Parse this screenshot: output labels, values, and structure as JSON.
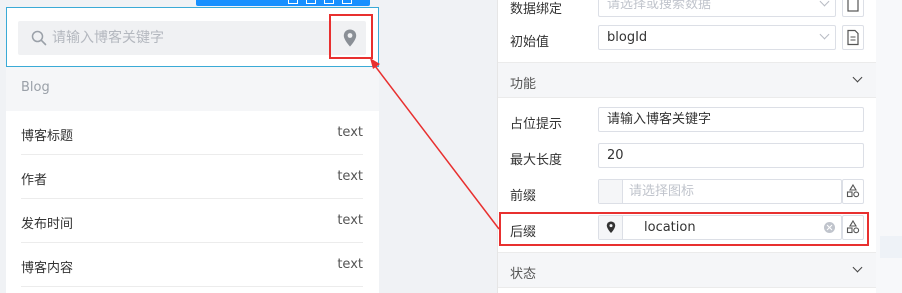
{
  "canvas": {
    "search": {
      "placeholder": "请输入博客关键字",
      "prefix_icon": "search-icon",
      "suffix_icon": "location-icon"
    },
    "list": {
      "header": "Blog",
      "rows": [
        {
          "name": "博客标题",
          "type": "text"
        },
        {
          "name": "作者",
          "type": "text"
        },
        {
          "name": "发布时间",
          "type": "text"
        },
        {
          "name": "博客内容",
          "type": "text"
        }
      ]
    }
  },
  "properties": {
    "data_binding": {
      "label": "数据绑定",
      "placeholder": "请选择或搜索数据"
    },
    "initial_value": {
      "label": "初始值",
      "value": "blogId"
    },
    "section_function": {
      "title": "功能"
    },
    "placeholder_hint": {
      "label": "占位提示",
      "value": "请输入博客关键字"
    },
    "max_length": {
      "label": "最大长度",
      "value": "20"
    },
    "prefix": {
      "label": "前缀",
      "placeholder": "请选择图标"
    },
    "suffix": {
      "label": "后缀",
      "icon": "location-icon",
      "value": "location"
    },
    "section_status": {
      "title": "状态"
    }
  },
  "colors": {
    "accent": "#1890ff",
    "selection_border": "#3aaad6",
    "highlight_red": "#e8302f"
  }
}
